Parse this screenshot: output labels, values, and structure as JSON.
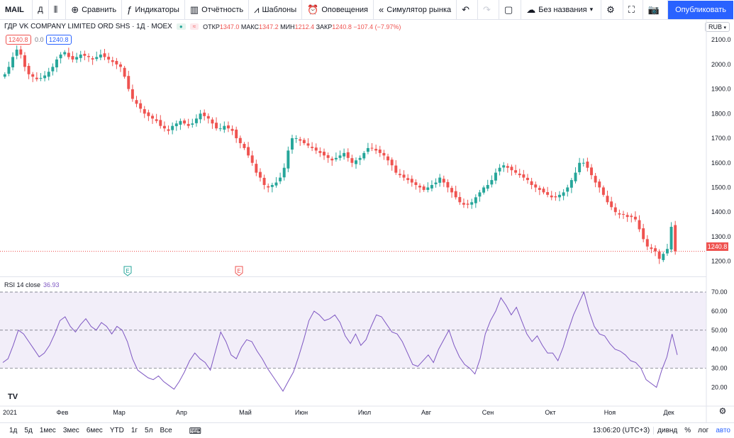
{
  "toolbar": {
    "symbol": "MAIL",
    "interval": "Д",
    "compare": "Сравнить",
    "indicators": "Индикаторы",
    "reports": "Отчётность",
    "templates": "Шаблоны",
    "alerts": "Оповещения",
    "replay": "Симулятор рынка",
    "layout_name": "Без названия",
    "publish": "Опубликовать"
  },
  "legend": {
    "title": "ГДР VK COMPANY LIMITED ORD SHS · 1Д · MOEX",
    "open_label": "ОТКР",
    "open": "1347.0",
    "high_label": "МАКС",
    "high": "1347.2",
    "low_label": "МИН",
    "low": "1212.4",
    "close_label": "ЗАКР",
    "close": "1240.8",
    "change": "−107.4 (−7.97%)",
    "bid": "1240.8",
    "spread": "0.0",
    "ask": "1240.8"
  },
  "currency": "RUB",
  "last_price_label": "1240.8",
  "rsi": {
    "label": "RSI 14 close",
    "value": "36.93"
  },
  "bottom": {
    "ranges": [
      "1д",
      "5д",
      "1мес",
      "3мес",
      "6мес",
      "YTD",
      "1г",
      "5л",
      "Все"
    ],
    "time": "13:06:20 (UTC+3)",
    "divs": "дивнд",
    "pct": "%",
    "log": "лог",
    "auto": "авто"
  },
  "colors": {
    "up": "#26a69a",
    "down": "#ef5350",
    "rsi": "#7e57c2",
    "accent": "#2962ff"
  },
  "chart_data": [
    {
      "type": "candlestick",
      "price_axis": [
        "2100.0",
        "2000.0",
        "1900.0",
        "1800.0",
        "1700.0",
        "1600.0",
        "1500.0",
        "1400.0",
        "1300.0",
        "1200.0"
      ],
      "ylim": [
        1150,
        2135
      ],
      "x_labels": [
        "2021",
        "Фев",
        "Мар",
        "Апр",
        "Май",
        "Июн",
        "Июл",
        "Авг",
        "Сен",
        "Окт",
        "Ноя",
        "Дек"
      ],
      "closes": [
        1960,
        1990,
        2030,
        2060,
        2040,
        1990,
        1960,
        1950,
        1940,
        1945,
        1955,
        1970,
        1990,
        2020,
        2040,
        2050,
        2030,
        2020,
        2030,
        2040,
        2035,
        2030,
        2020,
        2030,
        2040,
        2030,
        2020,
        2010,
        2000,
        1990,
        1950,
        1900,
        1860,
        1840,
        1820,
        1800,
        1790,
        1780,
        1770,
        1750,
        1740,
        1730,
        1750,
        1760,
        1770,
        1760,
        1750,
        1760,
        1780,
        1800,
        1790,
        1780,
        1760,
        1740,
        1740,
        1750,
        1740,
        1730,
        1700,
        1680,
        1660,
        1630,
        1600,
        1560,
        1540,
        1510,
        1500,
        1510,
        1520,
        1540,
        1580,
        1650,
        1700,
        1700,
        1690,
        1680,
        1670,
        1660,
        1650,
        1640,
        1630,
        1620,
        1610,
        1620,
        1630,
        1640,
        1620,
        1600,
        1610,
        1620,
        1640,
        1660,
        1660,
        1650,
        1640,
        1630,
        1610,
        1590,
        1560,
        1550,
        1540,
        1530,
        1520,
        1510,
        1500,
        1490,
        1500,
        1510,
        1520,
        1540,
        1520,
        1500,
        1480,
        1460,
        1440,
        1430,
        1430,
        1440,
        1460,
        1480,
        1500,
        1510,
        1530,
        1560,
        1580,
        1590,
        1580,
        1570,
        1560,
        1550,
        1540,
        1530,
        1510,
        1500,
        1490,
        1480,
        1470,
        1460,
        1460,
        1470,
        1480,
        1500,
        1530,
        1560,
        1600,
        1600,
        1580,
        1550,
        1520,
        1500,
        1470,
        1440,
        1420,
        1400,
        1390,
        1390,
        1380,
        1380,
        1370,
        1330,
        1290,
        1260,
        1250,
        1240,
        1210,
        1230,
        1250,
        1340,
        1240.8
      ]
    },
    {
      "type": "line",
      "name": "RSI 14 close",
      "y_axis": [
        "70.00",
        "60.00",
        "50.00",
        "40.00",
        "30.00",
        "20.00"
      ],
      "ylim": [
        12,
        73
      ],
      "bands": [
        30,
        50,
        70
      ],
      "values": [
        33,
        35,
        42,
        50,
        48,
        44,
        40,
        36,
        38,
        42,
        48,
        55,
        57,
        52,
        49,
        53,
        56,
        52,
        50,
        54,
        52,
        48,
        52,
        50,
        44,
        35,
        29,
        27,
        25,
        24,
        26,
        23,
        21,
        19,
        23,
        28,
        34,
        38,
        35,
        33,
        29,
        39,
        49,
        44,
        37,
        35,
        41,
        45,
        44,
        39,
        35,
        30,
        26,
        22,
        18,
        23,
        28,
        36,
        45,
        55,
        60,
        58,
        55,
        56,
        58,
        54,
        47,
        43,
        48,
        42,
        45,
        52,
        58,
        57,
        53,
        49,
        48,
        44,
        38,
        32,
        31,
        34,
        37,
        33,
        40,
        45,
        50,
        42,
        36,
        32,
        30,
        27,
        35,
        48,
        55,
        60,
        67,
        63,
        58,
        62,
        55,
        48,
        44,
        47,
        42,
        38,
        38,
        34,
        41,
        50,
        58,
        64,
        70,
        60,
        52,
        48,
        47,
        43,
        40,
        39,
        37,
        34,
        33,
        30,
        24,
        22,
        20,
        29,
        36,
        48,
        37
      ]
    }
  ]
}
